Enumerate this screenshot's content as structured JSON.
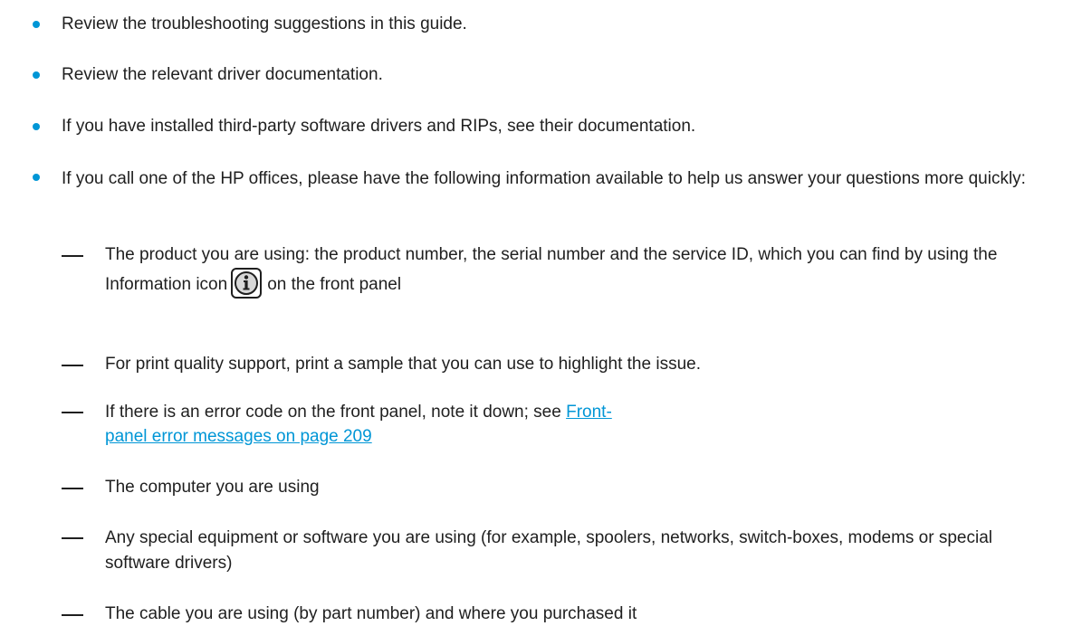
{
  "bullets": [
    "Review the troubleshooting suggestions in this guide.",
    "Review the relevant driver documentation.",
    "If you have installed third-party software drivers and RIPs, see their documentation.",
    "If you call one of the HP offices, please have the following information available to help us answer your questions more quickly:"
  ],
  "subitems": {
    "product_pre": "The product you are using: the product number, the serial number and the service ID, which you can find by using the Information icon",
    "product_post": "on the front panel",
    "print_quality": "For print quality support, print a sample that you can use to highlight the issue.",
    "error_pre": "If there is an error code on the front panel, note it down; see",
    "error_link": "Front-panel error messages on page 209",
    "computer": "The computer you are using",
    "equipment": "Any special equipment or software you are using (for example, spoolers, networks, switch-boxes, modems or special software drivers)",
    "cable": "The cable you are using (by part number) and where you purchased it"
  },
  "icons": {
    "info": "information-icon"
  },
  "colors": {
    "bullet": "#0096d6",
    "link": "#0096d6",
    "text": "#1f1f1f"
  }
}
